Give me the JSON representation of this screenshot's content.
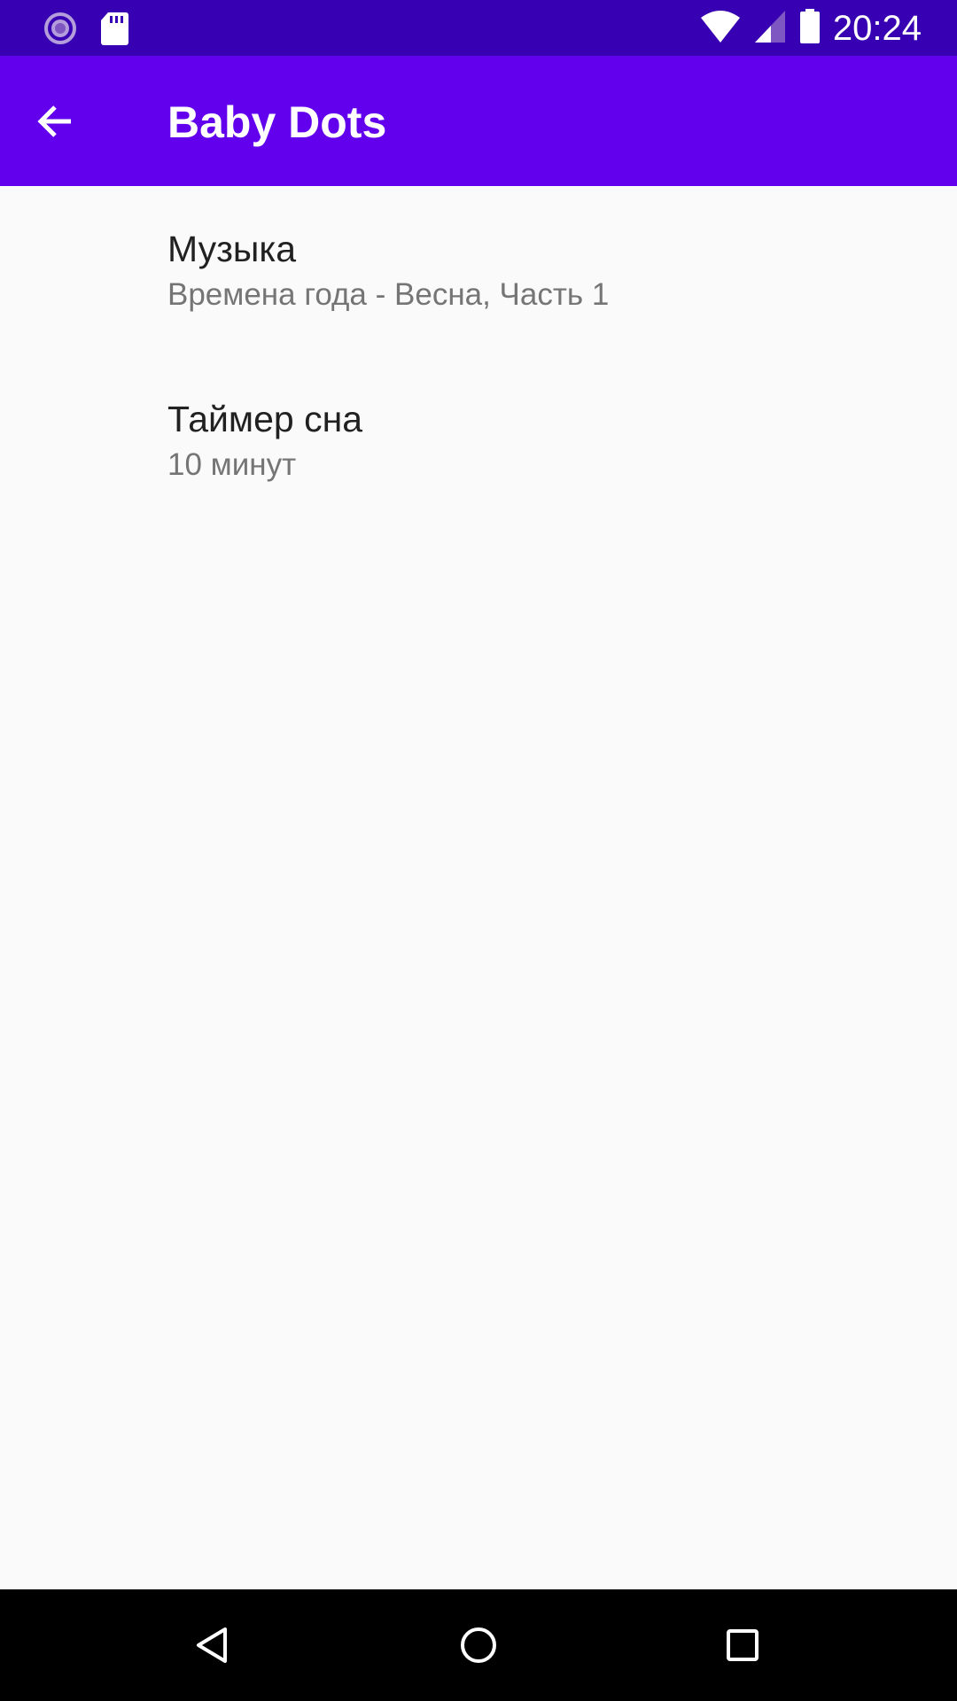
{
  "status_bar": {
    "time": "20:24",
    "icons": [
      "sync-icon",
      "sd-card-icon",
      "wifi-icon",
      "cell-signal-icon",
      "battery-icon"
    ]
  },
  "app_bar": {
    "title": "Baby Dots",
    "back_icon": "arrow-back-icon"
  },
  "preferences": [
    {
      "title": "Музыка",
      "summary": "Времена года - Весна, Часть 1"
    },
    {
      "title": "Таймер сна",
      "summary": "10 минут"
    }
  ],
  "nav_bar": {
    "icons": [
      "nav-back-icon",
      "nav-home-icon",
      "nav-recents-icon"
    ]
  },
  "colors": {
    "status_bar": "#3700b3",
    "app_bar": "#6200ee",
    "background": "#fafafa",
    "title_text": "#212121",
    "summary_text": "#757575"
  }
}
